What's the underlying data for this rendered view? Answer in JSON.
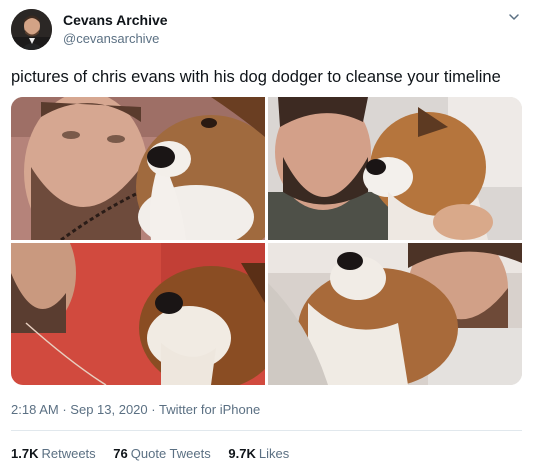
{
  "author": {
    "name": "Cevans Archive",
    "handle": "@cevansarchive",
    "avatar_icon": "profile-photo-icon"
  },
  "tweet": {
    "text": "pictures of chris evans with his dog dodger to cleanse your timeline"
  },
  "media": {
    "photos": [
      {
        "subject": "man with beard cheek to cheek with brown and white dog"
      },
      {
        "subject": "man with beard hugging dog in bed"
      },
      {
        "subject": "dog resting on man's shoulder in red shirt"
      },
      {
        "subject": "man lying next to dog looking up"
      }
    ]
  },
  "meta": {
    "time": "2:18 AM",
    "separator": "·",
    "date": "Sep 13, 2020",
    "source": "Twitter for iPhone"
  },
  "stats": {
    "retweets_count": "1.7K",
    "retweets_label": "Retweets",
    "quotes_count": "76",
    "quotes_label": "Quote Tweets",
    "likes_count": "9.7K",
    "likes_label": "Likes"
  },
  "colors": {
    "text": "#0f1419",
    "secondary": "#5b7083",
    "divider": "#e1e8ed"
  }
}
